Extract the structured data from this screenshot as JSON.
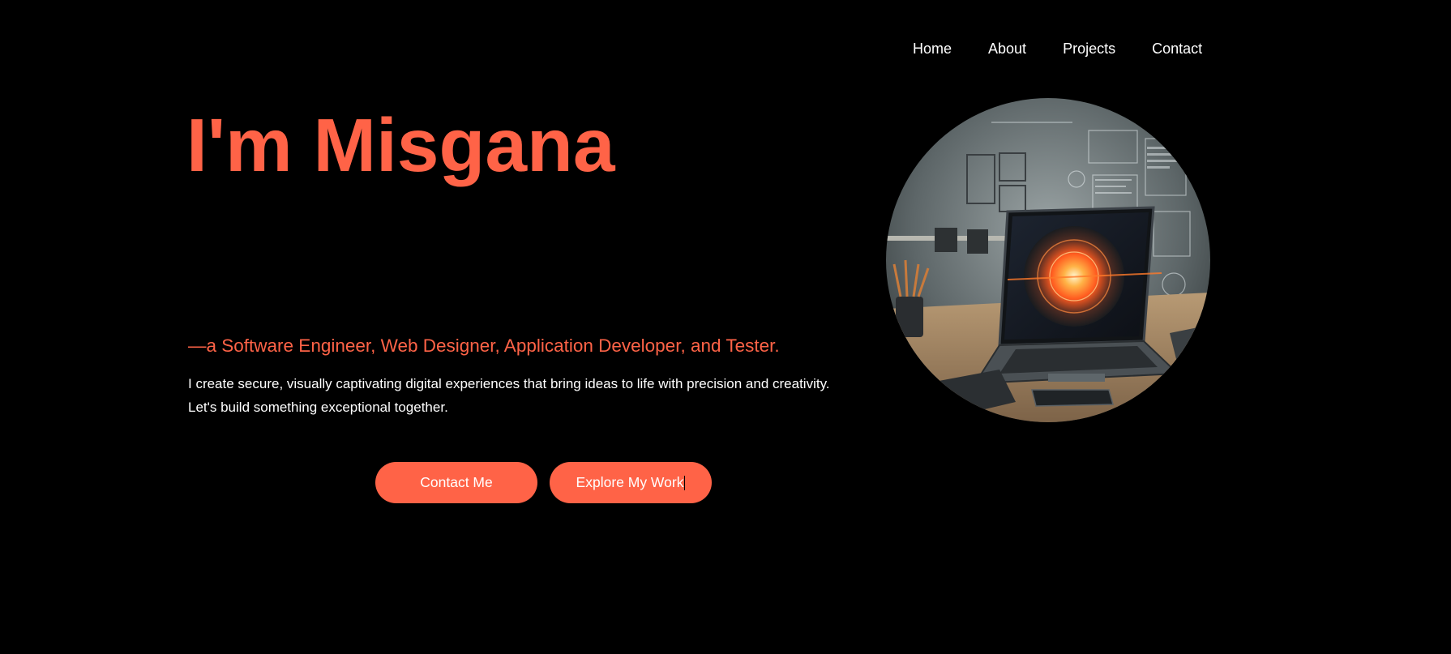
{
  "nav": {
    "items": [
      {
        "label": "Home"
      },
      {
        "label": "About"
      },
      {
        "label": "Projects"
      },
      {
        "label": "Contact"
      }
    ]
  },
  "hero": {
    "title": "I'm Misgana",
    "tagline": "—a Software Engineer, Web Designer, Application Developer, and Tester.",
    "description": "I create secure, visually captivating digital experiences that bring ideas to life with precision and creativity. Let's build something exceptional together.",
    "contact_button": "Contact Me",
    "explore_button": "Explore My Work"
  },
  "colors": {
    "accent": "#ff6347",
    "background": "#000000",
    "text": "#ffffff"
  },
  "image": {
    "subject": "laptop-workspace-illustration"
  }
}
